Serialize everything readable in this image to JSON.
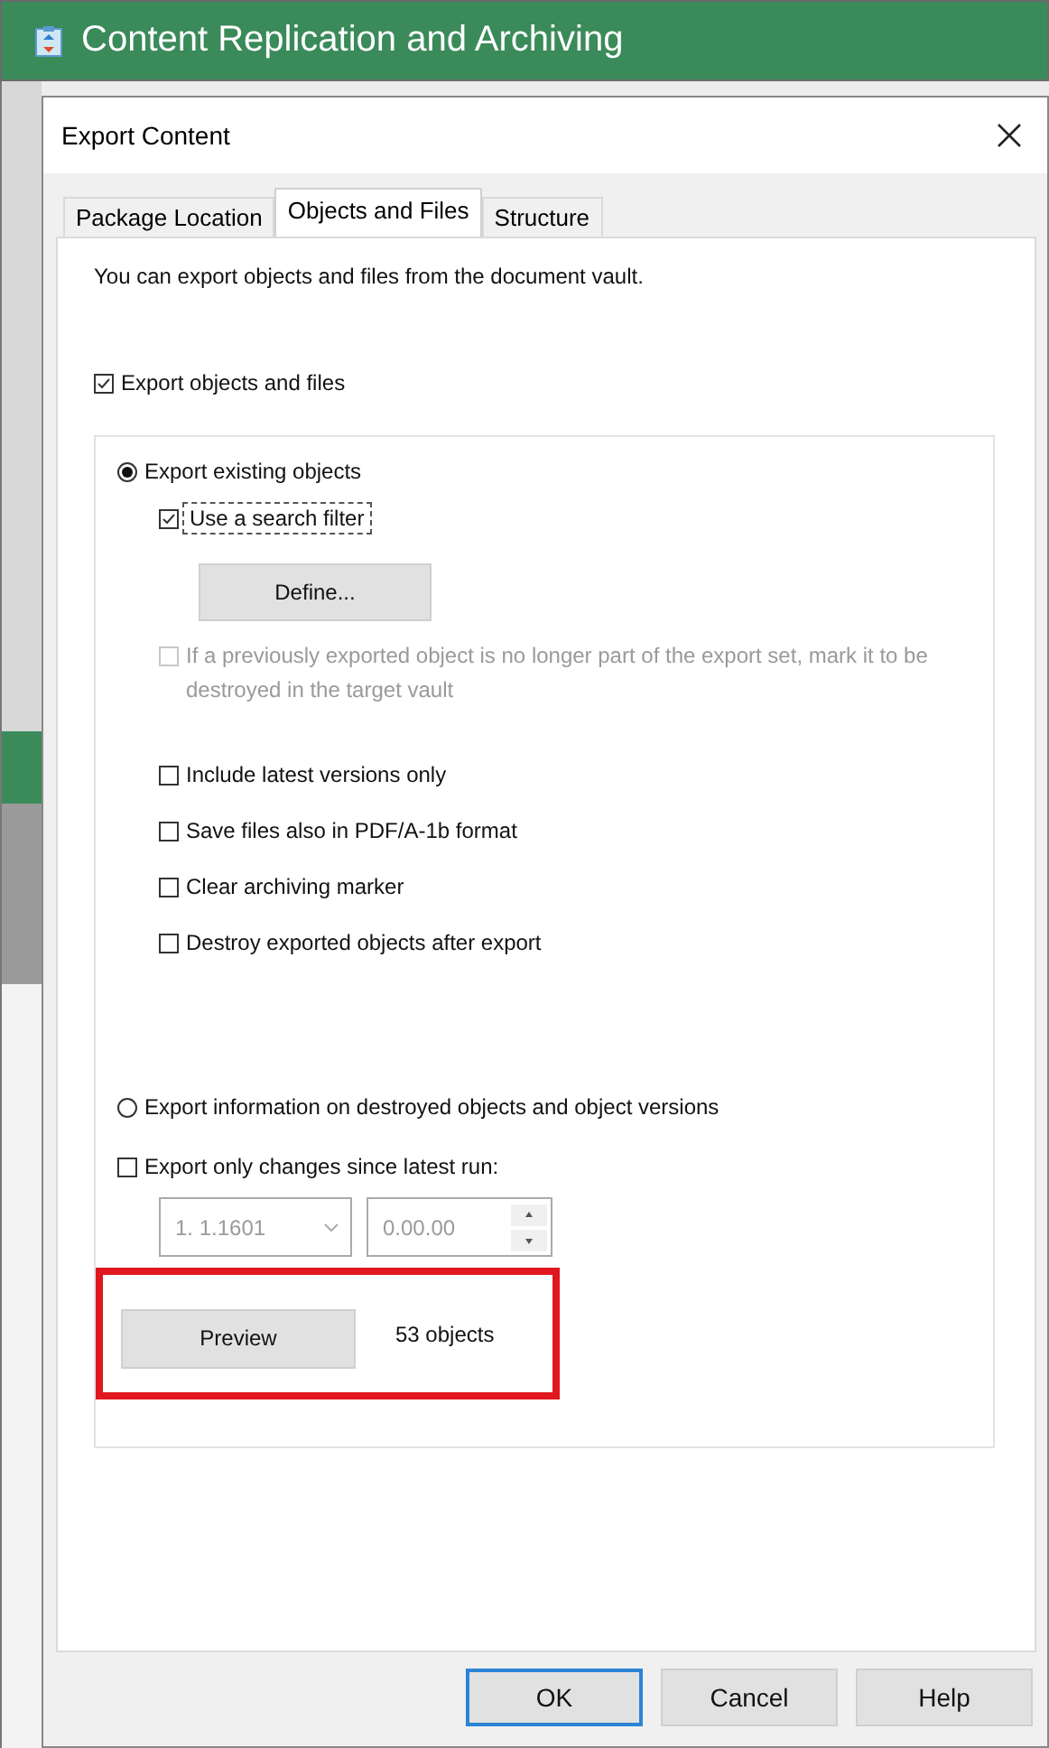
{
  "app": {
    "title": "Content Replication and Archiving"
  },
  "dialog": {
    "title": "Export Content"
  },
  "tabs": [
    {
      "label": "Package Location",
      "selected": false
    },
    {
      "label": "Objects and Files",
      "selected": true
    },
    {
      "label": "Structure",
      "selected": false
    }
  ],
  "intro": "You can export objects and files from the document vault.",
  "export_objects": {
    "label": "Export objects and files",
    "checked": true
  },
  "group": {
    "existing": {
      "label": "Export existing objects",
      "selected": true
    },
    "search_filter": {
      "label": "Use a search filter",
      "checked": true,
      "focused": true
    },
    "define_button": "Define...",
    "destroy_missing": {
      "label": "If a previously exported object is no longer part of the export set, mark it to be destroyed in the target vault",
      "checked": false,
      "disabled": true
    },
    "checkboxes": [
      {
        "label": "Include latest versions only",
        "checked": false
      },
      {
        "label": "Save files also in PDF/A-1b format",
        "checked": false
      },
      {
        "label": "Clear archiving marker",
        "checked": false
      },
      {
        "label": "Destroy exported objects after export",
        "checked": false
      }
    ],
    "destroyed_info": {
      "label": "Export information on destroyed objects and object versions",
      "selected": false
    },
    "changes_only": {
      "label": "Export only changes since latest run:",
      "checked": false
    },
    "date_field": {
      "value": "1.  1.1601",
      "disabled": true
    },
    "time_field": {
      "value": "0.00.00",
      "disabled": true
    },
    "preview_button": "Preview",
    "object_count": "53 objects"
  },
  "buttons": [
    {
      "label": "OK",
      "default": true
    },
    {
      "label": "Cancel",
      "default": false
    },
    {
      "label": "Help",
      "default": false
    }
  ]
}
